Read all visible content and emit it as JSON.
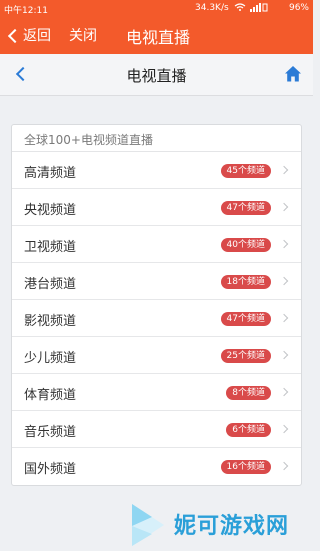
{
  "status_bar": {
    "time": "中午12:11",
    "speed": "34.3K/s",
    "battery": "96%"
  },
  "app_bar": {
    "back_label": "返回",
    "close_label": "关闭",
    "title": "电视直播"
  },
  "nav_bar": {
    "title": "电视直播"
  },
  "card": {
    "header": "全球100+电视频道直播",
    "rows": [
      {
        "label": "高清频道",
        "count": "45个频道"
      },
      {
        "label": "央视频道",
        "count": "47个频道"
      },
      {
        "label": "卫视频道",
        "count": "40个频道"
      },
      {
        "label": "港台频道",
        "count": "18个频道"
      },
      {
        "label": "影视频道",
        "count": "47个频道"
      },
      {
        "label": "少儿频道",
        "count": "25个频道"
      },
      {
        "label": "体育频道",
        "count": "8个频道"
      },
      {
        "label": "音乐频道",
        "count": "6个频道"
      },
      {
        "label": "国外频道",
        "count": "16个频道"
      }
    ]
  },
  "watermark": {
    "text": "妮可游戏网"
  },
  "colors": {
    "accent": "#f35a2b",
    "badge": "#d94a4a",
    "link": "#2b7bd6"
  },
  "icons": {
    "home": "home-icon",
    "back": "back-chevron-icon"
  }
}
